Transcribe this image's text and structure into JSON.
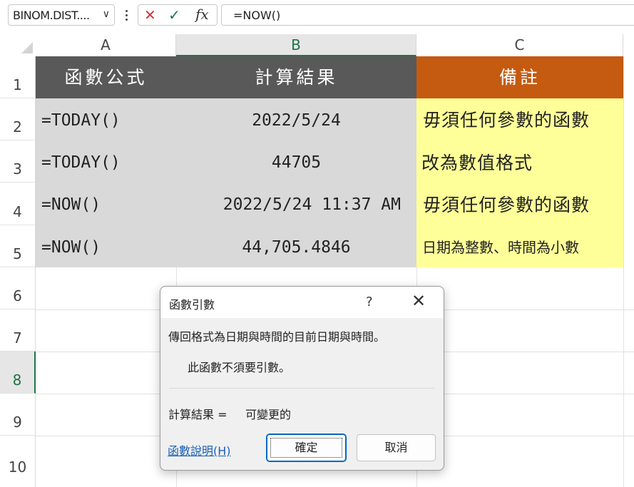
{
  "formula_bar": {
    "name_box": "BINOM.DIST....",
    "cancel_symbol": "✕",
    "enter_symbol": "✓",
    "fx_label": "fx",
    "formula": "=NOW()"
  },
  "columns": [
    "A",
    "B",
    "C"
  ],
  "rows": [
    "1",
    "2",
    "3",
    "4",
    "5",
    "6",
    "7",
    "8",
    "9",
    "10"
  ],
  "sheet": {
    "header": {
      "a": "函數公式",
      "b": "計算結果",
      "c": "備註"
    },
    "data_rows": [
      {
        "a": "=TODAY()",
        "b": "2022/5/24",
        "c": "毋須任何參數的函數"
      },
      {
        "a": "=TODAY()",
        "b": "44705",
        "c": "改為數值格式"
      },
      {
        "a": "=NOW()",
        "b": "2022/5/24 11:37 AM",
        "c": "毋須任何參數的函數"
      },
      {
        "a": "=NOW()",
        "b": "44,705.4846",
        "c": "日期為整數、時間為小數"
      }
    ]
  },
  "dialog": {
    "title": "函數引數",
    "help_symbol": "?",
    "close_symbol": "✕",
    "description": "傳回格式為日期與時間的目前日期與時間。",
    "note": "此函數不須要引數。",
    "result_label": "計算結果 =",
    "result_value": "可變更的",
    "help_link": "函數說明(H)",
    "ok_label": "確定",
    "cancel_label": "取消"
  },
  "colors": {
    "header_gray": "#595959",
    "header_orange": "#c55a11",
    "cell_gray": "#d9d9d9",
    "cell_yellow": "#ffff99",
    "selection_green": "#217346"
  }
}
